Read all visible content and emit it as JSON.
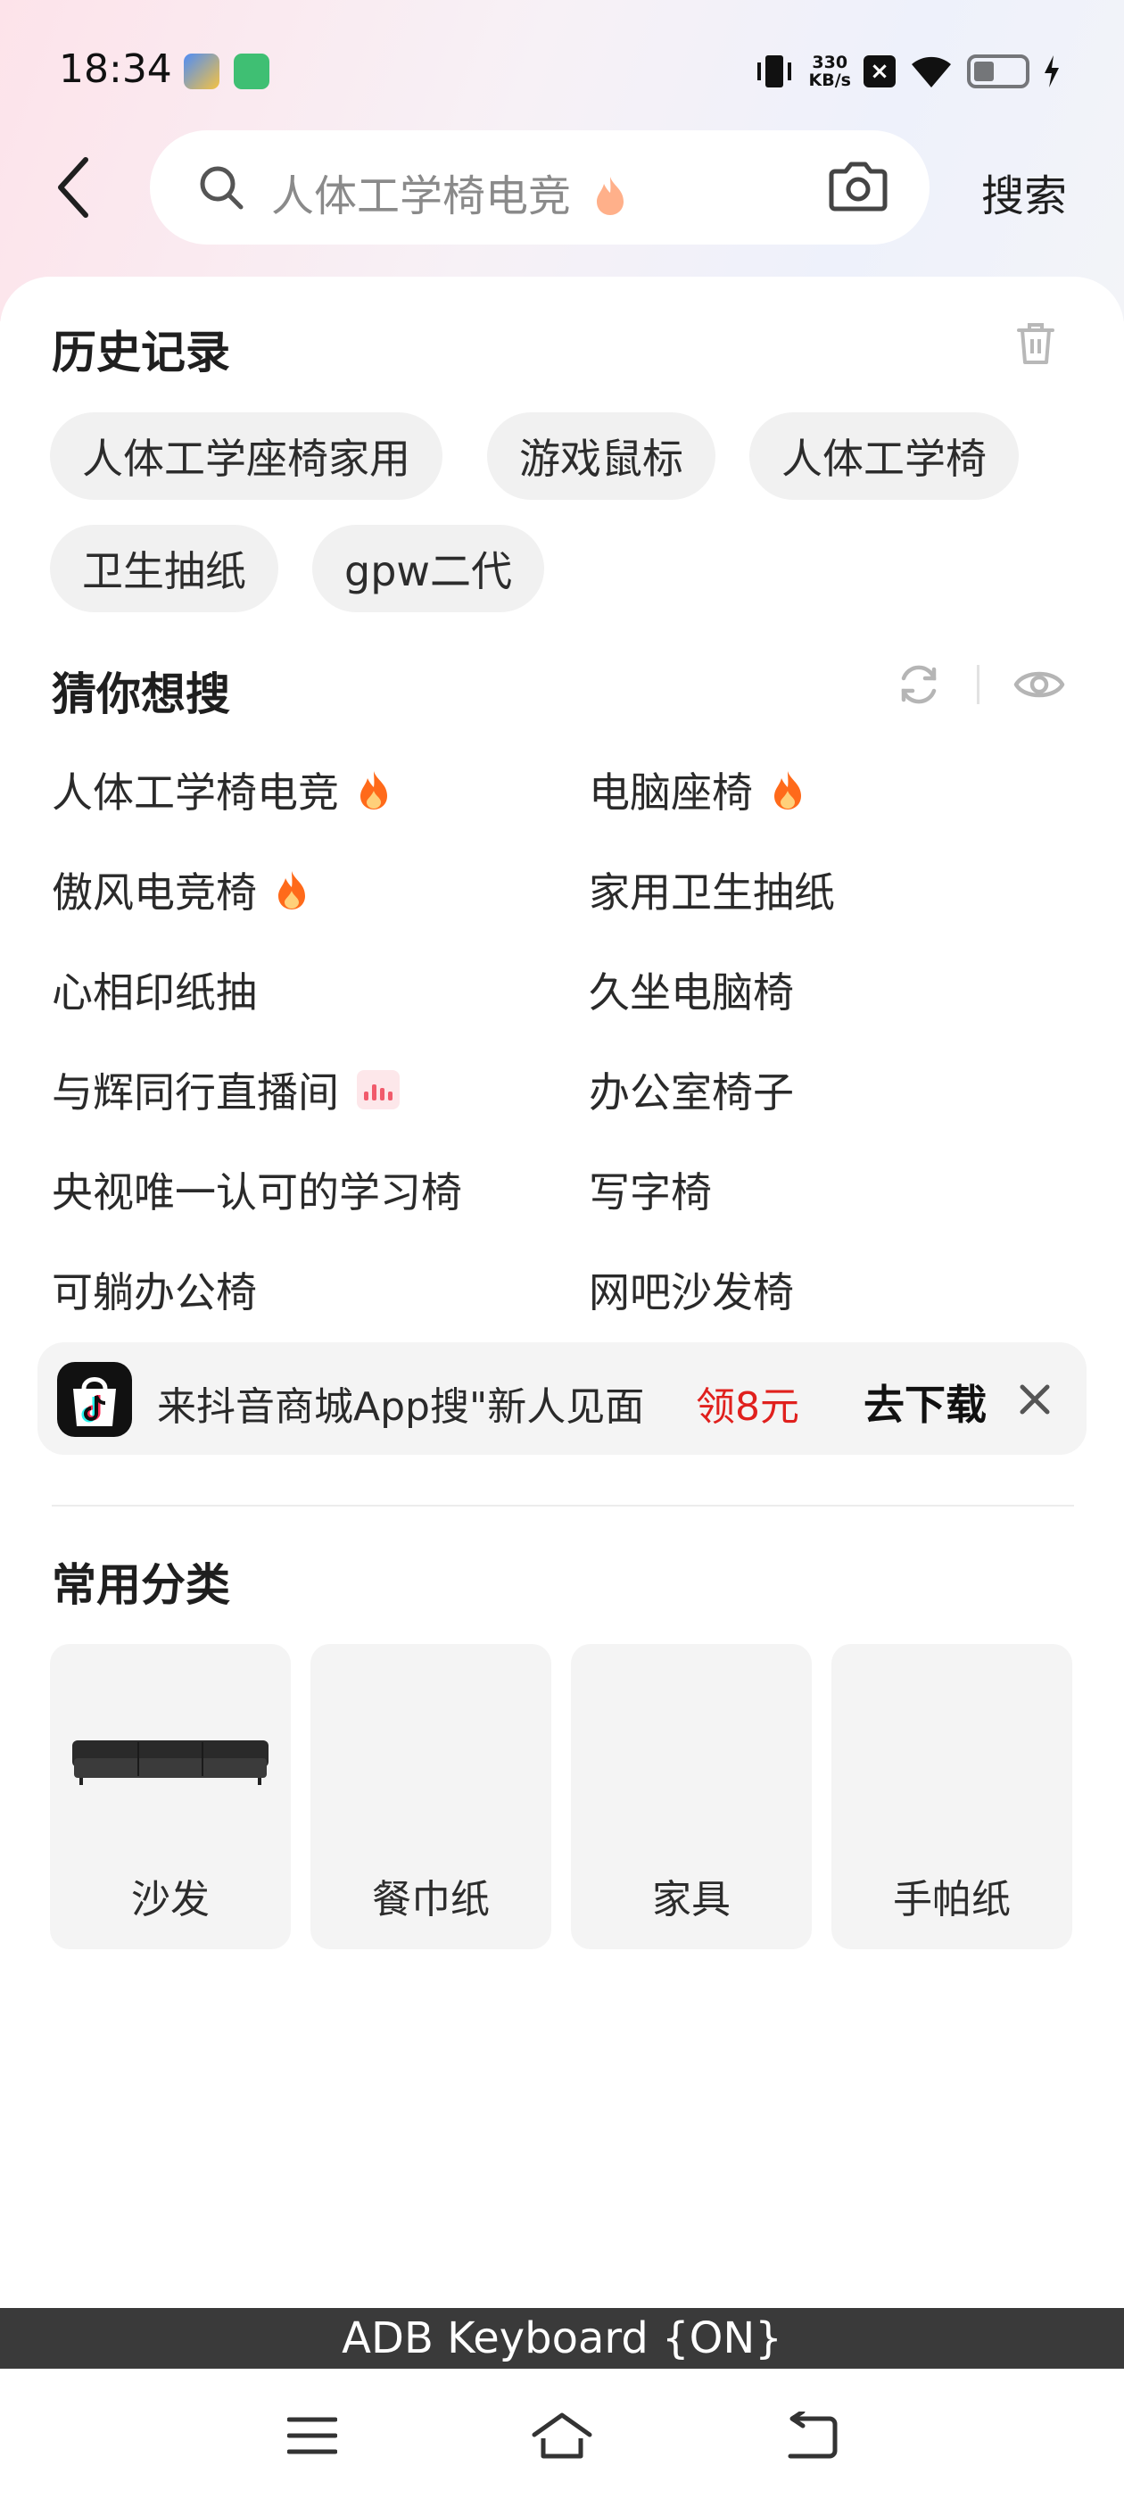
{
  "status_bar": {
    "time": "18:34",
    "net_speed_value": "330",
    "net_speed_unit": "KB/s"
  },
  "header": {
    "search_placeholder": "人体工学椅电竞",
    "search_button": "搜索"
  },
  "history": {
    "title": "历史记录",
    "chips": [
      "人体工学座椅家用",
      "游戏鼠标",
      "人体工学椅",
      "卫生抽纸",
      "gpw二代"
    ]
  },
  "guess": {
    "title": "猜你想搜",
    "left": [
      "人体工学椅电竞",
      "傲风电竞椅",
      "心相印纸抽",
      "与辉同行直播间",
      "央视唯一认可的学习椅",
      "可躺办公椅"
    ],
    "right": [
      "电脑座椅",
      "家用卫生抽纸",
      "久坐电脑椅",
      "办公室椅子",
      "写字椅",
      "网吧沙发椅"
    ]
  },
  "promo": {
    "text": "来抖音商城App搜\"新人见面",
    "reward": "领8元",
    "download": "去下载"
  },
  "categories": {
    "title": "常用分类",
    "items": [
      "沙发",
      "餐巾纸",
      "家具",
      "手帕纸"
    ]
  },
  "keyboard_banner": "ADB Keyboard {ON}",
  "colors": {
    "accent_red": "#e0201d",
    "hot_orange": "#ff6a1a"
  }
}
